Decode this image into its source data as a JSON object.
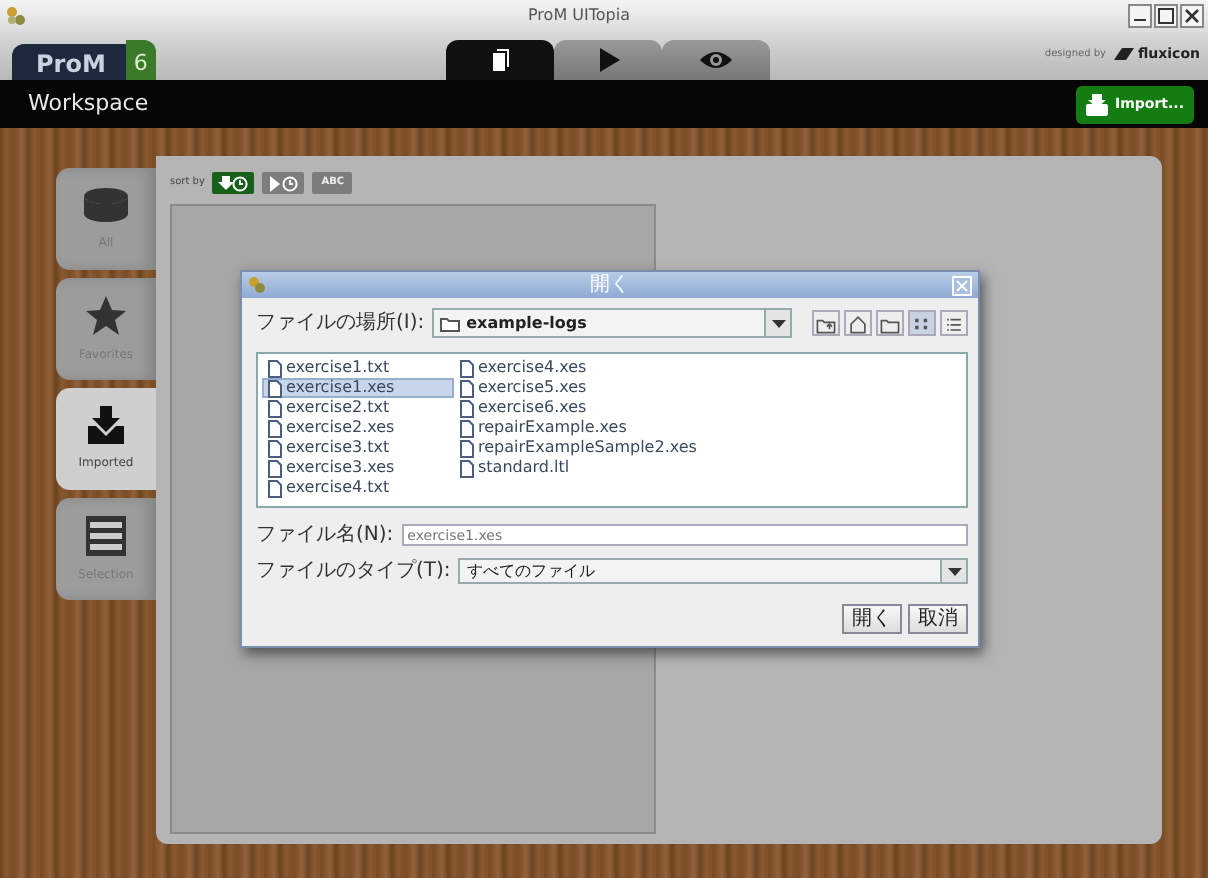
{
  "window": {
    "title": "ProM UITopia"
  },
  "header": {
    "logo": "ProM",
    "logo_version": "6",
    "credit_prefix": "designed by",
    "credit_brand": "fluxicon"
  },
  "mode_tabs": [
    {
      "kind": "copies",
      "selected": true
    },
    {
      "kind": "play",
      "selected": false
    },
    {
      "kind": "eye",
      "selected": false
    }
  ],
  "toolbar": {
    "title": "Workspace",
    "import_button": "Import..."
  },
  "side_tabs": [
    {
      "kind": "database",
      "label": "All",
      "selected": false
    },
    {
      "kind": "star",
      "label": "Favorites",
      "selected": false
    },
    {
      "kind": "import",
      "label": "Imported",
      "selected": true
    },
    {
      "kind": "selection",
      "label": "Selection",
      "selected": false
    }
  ],
  "sort": {
    "label": "sort by",
    "buttons": [
      {
        "kind": "import-time",
        "selected": true
      },
      {
        "kind": "run-time",
        "selected": false
      },
      {
        "kind": "text",
        "text": "ABC",
        "selected": false
      }
    ]
  },
  "dialog": {
    "title": "開く",
    "location_label": "ファイルの場所(I):",
    "location": "example-logs",
    "view_buttons": [
      {
        "kind": "up",
        "selected": false
      },
      {
        "kind": "home",
        "selected": false
      },
      {
        "kind": "new-folder",
        "selected": false
      },
      {
        "kind": "list",
        "selected": true
      },
      {
        "kind": "details",
        "selected": false
      }
    ],
    "files": [
      {
        "name": "exercise1.txt",
        "selected": false
      },
      {
        "name": "exercise1.xes",
        "selected": true
      },
      {
        "name": "exercise2.txt",
        "selected": false
      },
      {
        "name": "exercise2.xes",
        "selected": false
      },
      {
        "name": "exercise3.txt",
        "selected": false
      },
      {
        "name": "exercise3.xes",
        "selected": false
      },
      {
        "name": "exercise4.txt",
        "selected": false
      },
      {
        "name": "exercise4.xes",
        "selected": false
      },
      {
        "name": "exercise5.xes",
        "selected": false
      },
      {
        "name": "exercise6.xes",
        "selected": false
      },
      {
        "name": "repairExample.xes",
        "selected": false
      },
      {
        "name": "repairExampleSample2.xes",
        "selected": false
      },
      {
        "name": "standard.ltl",
        "selected": false
      }
    ],
    "filename_label": "ファイル名(N):",
    "filename": "exercise1.xes",
    "filetype_label": "ファイルのタイプ(T):",
    "filetype": "すべてのファイル",
    "buttons": [
      "開く",
      "取消"
    ]
  }
}
